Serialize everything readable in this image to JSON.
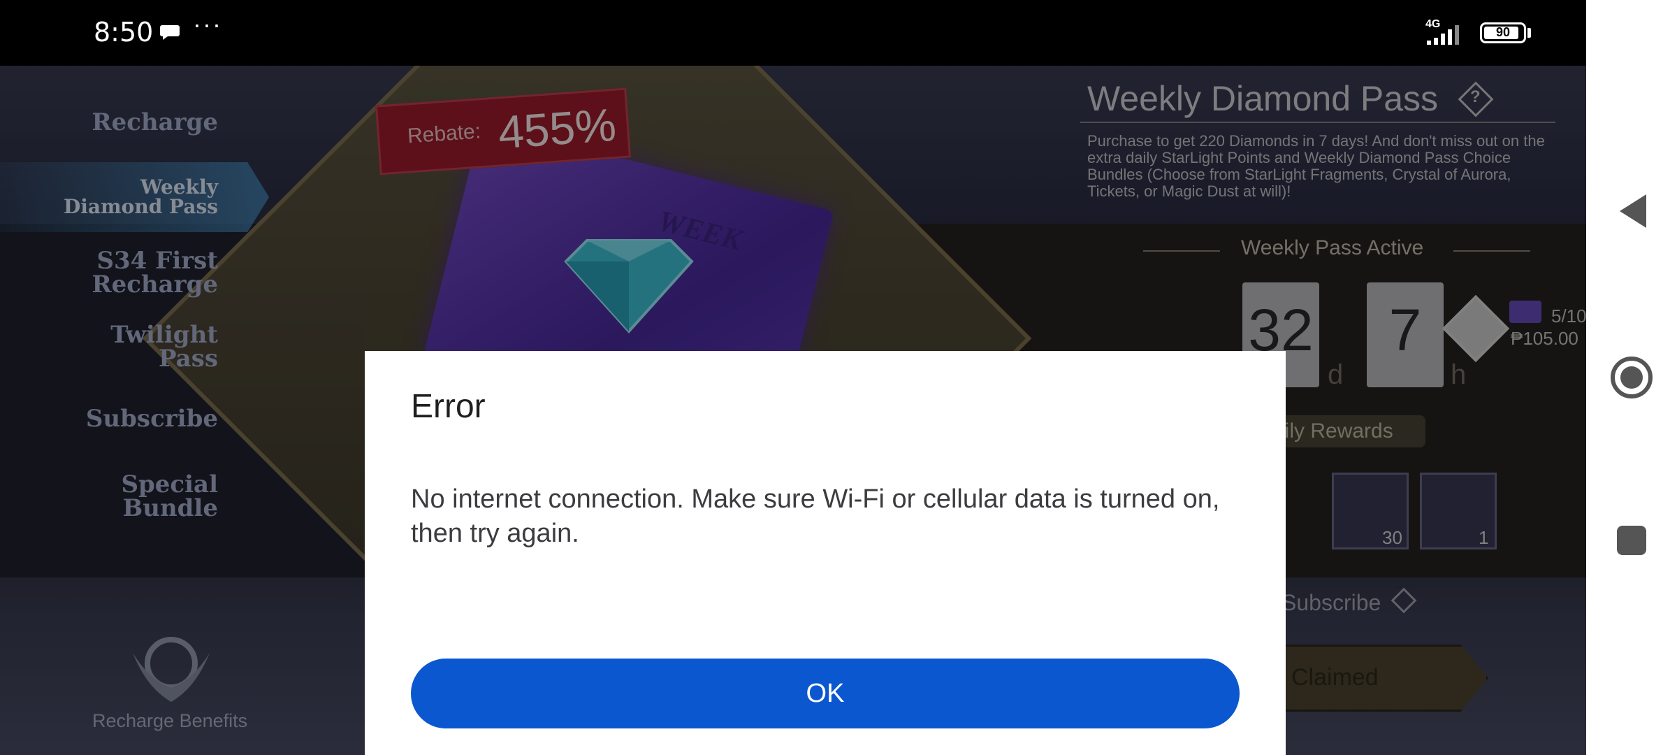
{
  "status_bar": {
    "time": "8:50",
    "more_indicator": "···",
    "network_type": "4G",
    "battery_percent": "90",
    "battery_level": 0.9
  },
  "game": {
    "rebate_label": "Rebate:",
    "rebate_value": "455%",
    "card_text": "WEEK",
    "menu": [
      {
        "label_line1": "Recharge",
        "label_line2": ""
      },
      {
        "label_line1": "Weekly",
        "label_line2": "Diamond Pass"
      },
      {
        "label_line1": "S34 First",
        "label_line2": "Recharge"
      },
      {
        "label_line1": "Twilight",
        "label_line2": "Pass"
      },
      {
        "label_line1": "Subscribe",
        "label_line2": ""
      },
      {
        "label_line1": "Special",
        "label_line2": "Bundle"
      }
    ],
    "recharge_benefits": "Recharge Benefits",
    "pass_title": "Weekly Diamond Pass",
    "pass_description": "Purchase to get 220 Diamonds in 7 days! And don't miss out on the extra daily StarLight Points and Weekly Diamond Pass Choice Bundles (Choose from StarLight Fragments, Crystal of Aurora, Tickets, or Magic Dust at will)!",
    "active_label": "Weekly Pass Active",
    "days_value": "32",
    "days_unit": "d",
    "hours_value": "7",
    "hours_unit": "h",
    "slot_count": "5/10",
    "slot_price": "₱105.00",
    "daily_rewards": "aily Rewards",
    "reward_1_qty": "30",
    "reward_2_qty": "1",
    "subscribe_label": "Subscribe",
    "claimed_label": "Claimed"
  },
  "dialog": {
    "title": "Error",
    "message": "No internet connection. Make sure Wi-Fi or cellular data is turned on, then try again.",
    "ok_label": "OK"
  },
  "colors": {
    "primary_button": "#0b57d0",
    "dialog_bg": "#ffffff",
    "status_bar_bg": "#000000"
  },
  "icons": {
    "chat": "chat-bubble-icon",
    "signal": "cellular-signal-icon",
    "battery": "battery-icon",
    "back": "nav-back-icon",
    "home": "nav-home-icon",
    "recents": "nav-recents-icon",
    "help": "help-diamond-icon"
  }
}
